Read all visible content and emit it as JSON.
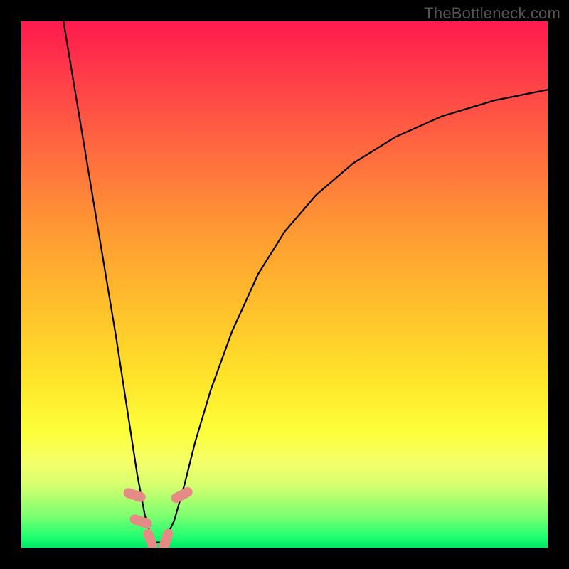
{
  "watermark": "TheBottleneck.com",
  "chart_data": {
    "type": "line",
    "title": "",
    "xlabel": "",
    "ylabel": "",
    "xlim": [
      0,
      100
    ],
    "ylim": [
      0,
      100
    ],
    "series": [
      {
        "name": "bottleneck-curve",
        "x": [
          8,
          10,
          12,
          14,
          16,
          18,
          20,
          22,
          23.5,
          25,
          27,
          29,
          31,
          33,
          36,
          40,
          45,
          50,
          56,
          63,
          71,
          80,
          90,
          100
        ],
        "y": [
          100,
          88,
          76,
          64,
          52,
          40,
          27,
          14,
          6,
          1,
          1,
          5,
          12,
          20,
          30,
          41,
          52,
          60,
          67,
          73,
          78,
          82,
          85,
          87
        ]
      }
    ],
    "markers": [
      {
        "name": "marker-left-upper",
        "x": 21.5,
        "y": 10,
        "angle": -72
      },
      {
        "name": "marker-left-lower",
        "x": 22.7,
        "y": 5,
        "angle": -72
      },
      {
        "name": "marker-bottom-left",
        "x": 24.5,
        "y": 1.5,
        "angle": -20
      },
      {
        "name": "marker-bottom-right",
        "x": 27.5,
        "y": 1.5,
        "angle": 20
      },
      {
        "name": "marker-right-upper",
        "x": 30.5,
        "y": 10,
        "angle": 62
      }
    ],
    "gradient_stops": [
      {
        "pos": 0,
        "color": "#ff1a4d"
      },
      {
        "pos": 25,
        "color": "#ff6b3f"
      },
      {
        "pos": 55,
        "color": "#ffc22b"
      },
      {
        "pos": 80,
        "color": "#fdff3a"
      },
      {
        "pos": 100,
        "color": "#00e865"
      }
    ]
  }
}
